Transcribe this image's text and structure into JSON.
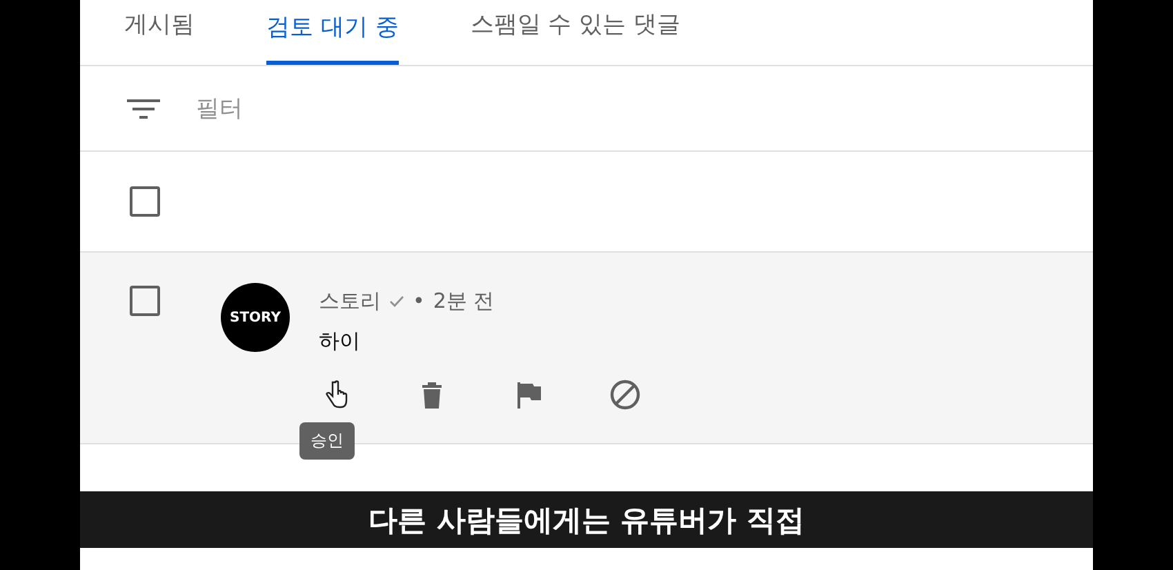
{
  "tabs": [
    {
      "label": "게시됨",
      "selected": false
    },
    {
      "label": "검토 대기 중",
      "selected": true
    },
    {
      "label": "스팸일 수 있는 댓글",
      "selected": false
    }
  ],
  "filter": {
    "placeholder": "필터"
  },
  "select_all": {
    "checked": false
  },
  "comments": [
    {
      "checked": false,
      "avatar_label": "STORY",
      "author": "스토리",
      "verified": true,
      "separator": "•",
      "time": "2분 전",
      "text": "하이",
      "actions": [
        {
          "kind": "approve",
          "tooltip": "승인"
        },
        {
          "kind": "delete"
        },
        {
          "kind": "flag"
        },
        {
          "kind": "block"
        }
      ]
    }
  ],
  "subtitle": "다른 사람들에게는 유튜버가 직접"
}
